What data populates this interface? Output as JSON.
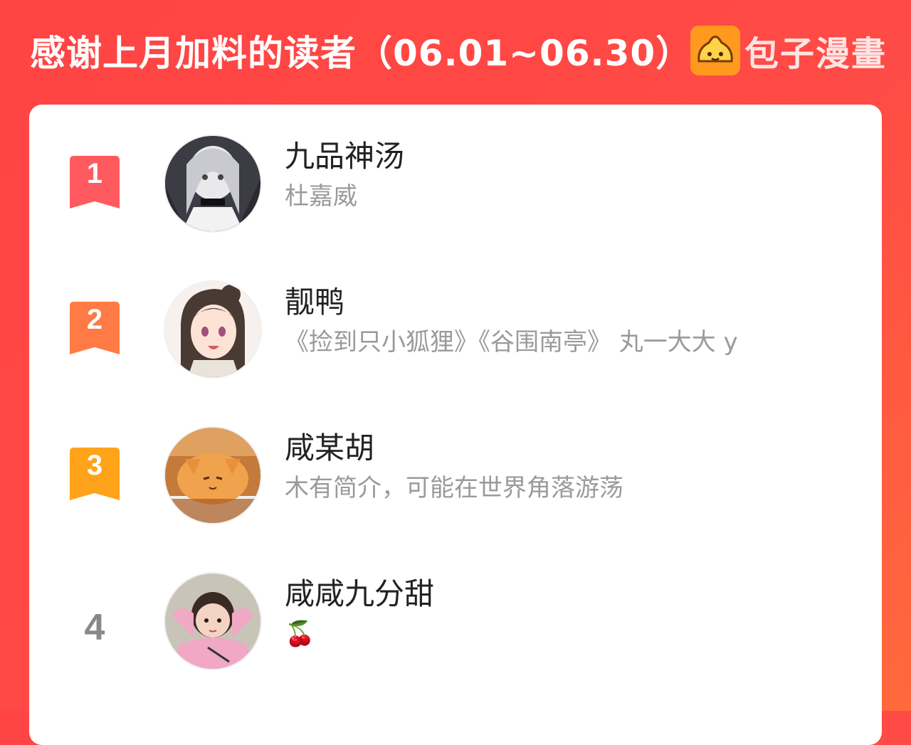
{
  "header": {
    "title": "感谢上月加料的读者（06.01~06.30）",
    "brand_name": "包子漫畫",
    "brand_icon": "bun-logo-icon"
  },
  "colors": {
    "background": "#ff4b45",
    "card": "#ffffff",
    "rank1": "#ff5a5f",
    "rank2": "#ff7a45",
    "rank3": "#ffa31a",
    "rank_plain": "#888888",
    "name_text": "#222222",
    "desc_text": "#9a9a9a"
  },
  "readers": [
    {
      "rank": "1",
      "name": "九品神汤",
      "description": "杜嘉威",
      "avatar": "anime-girl-avatar"
    },
    {
      "rank": "2",
      "name": "靓鸭",
      "description": "《捡到只小狐狸》《谷围南亭》 丸一大大 y",
      "avatar": "anime-girl-brown-hair-avatar"
    },
    {
      "rank": "3",
      "name": "咸某胡",
      "description": "木有简介，可能在世界角落游荡",
      "avatar": "kitten-avatar"
    },
    {
      "rank": "4",
      "name": "咸咸九分甜",
      "description": "🍒",
      "avatar": "child-photo-avatar"
    }
  ]
}
